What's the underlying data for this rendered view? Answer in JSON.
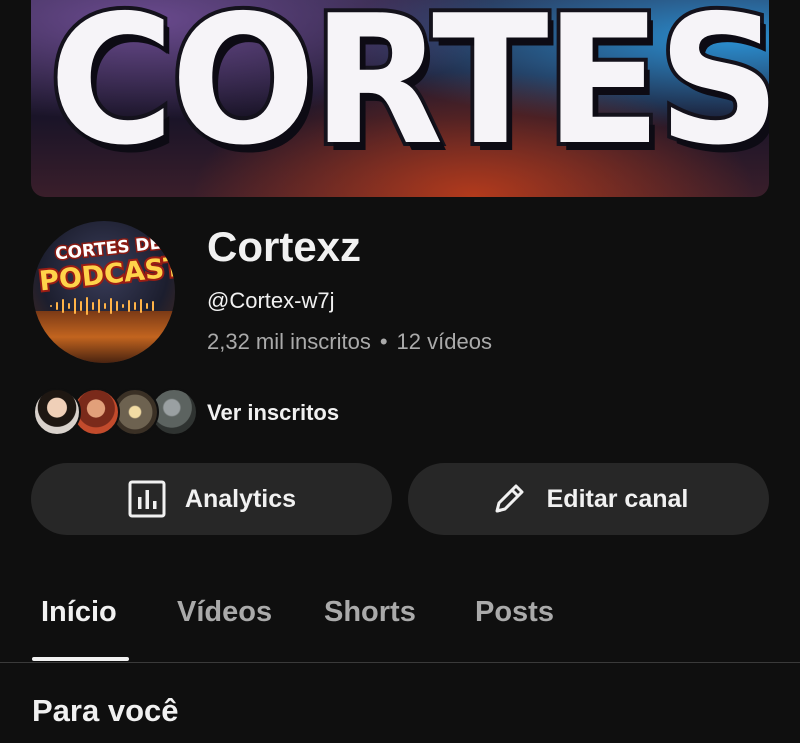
{
  "banner": {
    "text": "CORTES"
  },
  "avatar": {
    "line1": "CORTES DE",
    "line2": "PODCAST"
  },
  "channel": {
    "name": "Cortexz",
    "handle": "@Cortex-w7j",
    "subscribers": "2,32 mil inscritos",
    "separator": "•",
    "videos": "12 vídeos"
  },
  "subscribers_row": {
    "label": "Ver inscritos"
  },
  "buttons": {
    "analytics": "Analytics",
    "edit": "Editar canal"
  },
  "tabs": [
    {
      "label": "Início",
      "active": true
    },
    {
      "label": "Vídeos",
      "active": false
    },
    {
      "label": "Shorts",
      "active": false
    },
    {
      "label": "Posts",
      "active": false
    }
  ],
  "section": {
    "title": "Para você"
  },
  "colors": {
    "background": "#0f0f0f",
    "button_bg": "#272727",
    "text_primary": "#f1f1f1",
    "text_secondary": "#aaaaaa"
  }
}
